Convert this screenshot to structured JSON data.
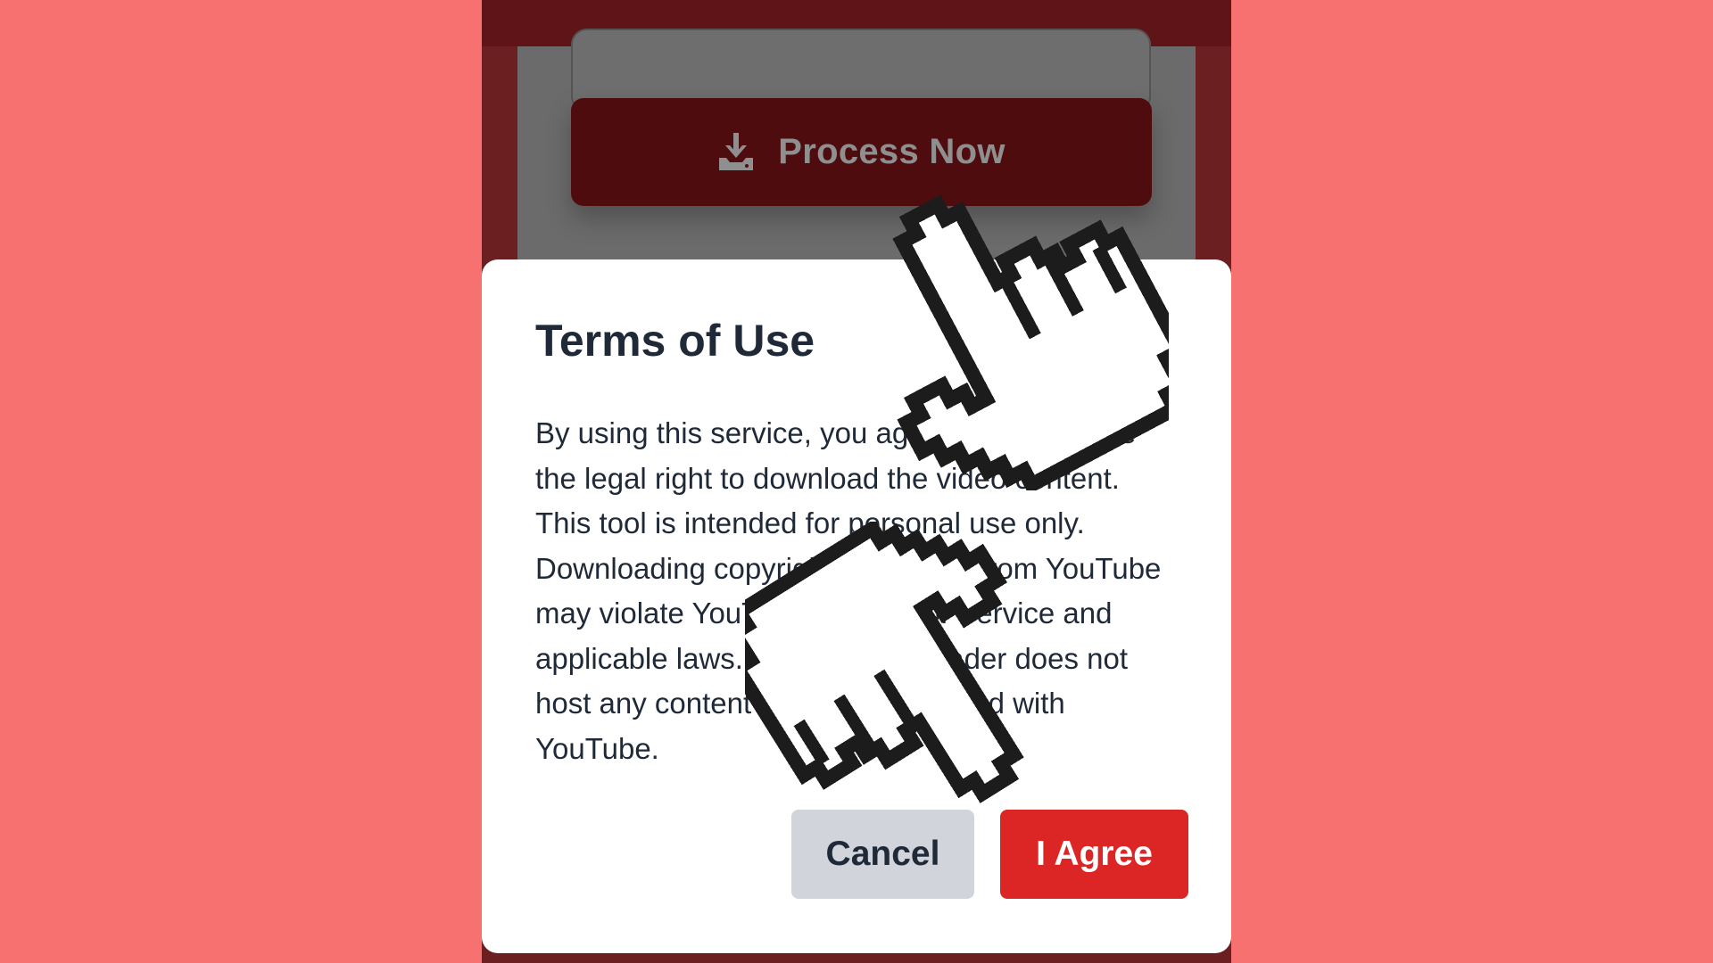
{
  "app": {
    "process_button": {
      "label": "Process Now",
      "icon": "download-icon"
    }
  },
  "dialog": {
    "title": "Terms of Use",
    "body": "By using this service, you agree that you have the legal right to download the video content. This tool is intended for personal use only. Downloading copyrighted content from YouTube may violate YouTube's Terms of Service and applicable laws. SafeYTDownloader does not host any content and is not affiliated with YouTube.",
    "cancel_label": "Cancel",
    "agree_label": "I Agree"
  },
  "overlay": {
    "cursor_icon": "pointing-hand-cursor-icon"
  },
  "colors": {
    "page_background": "#f87171",
    "accent_red": "#dc2626",
    "dark_red": "#4f0c0e",
    "cancel_gray": "#d1d5db",
    "text_dark": "#1f2937"
  }
}
